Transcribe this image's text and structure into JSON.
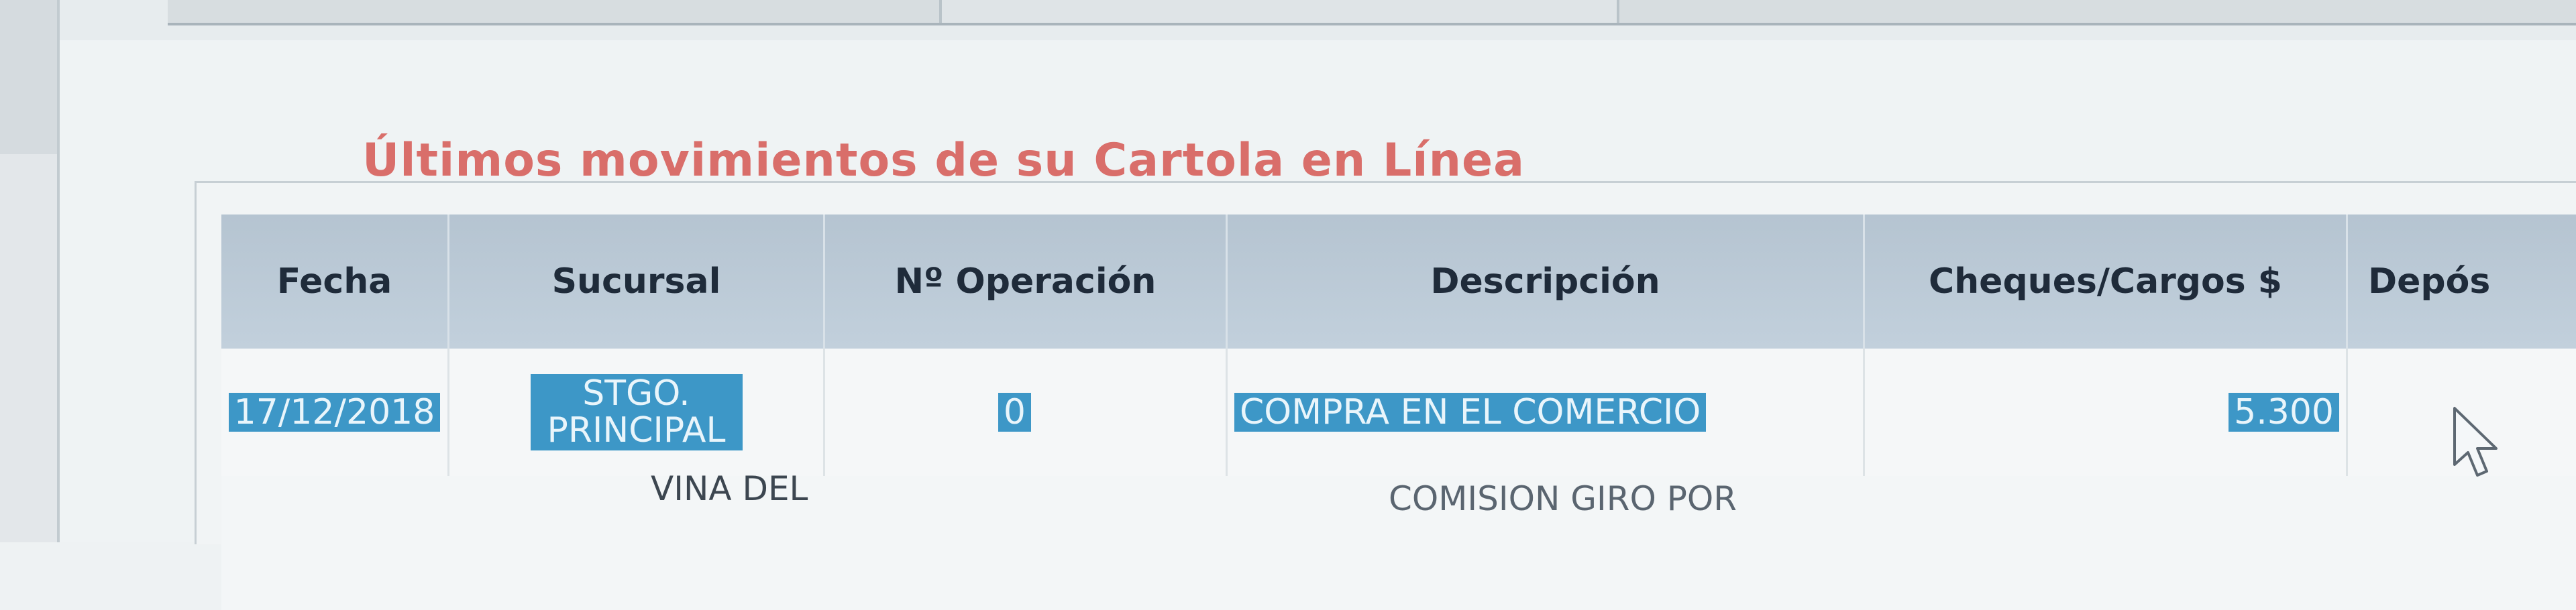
{
  "section": {
    "title": "Últimos movimientos de su Cartola en Línea"
  },
  "table": {
    "columns": [
      "Fecha",
      "Sucursal",
      "Nº Operación",
      "Descripción",
      "Cheques/Cargos $",
      "Depós"
    ],
    "rows": [
      {
        "fecha": "17/12/2018",
        "sucursal": "STGO. PRINCIPAL",
        "operacion": "0",
        "descripcion": "COMPRA EN EL COMERCIO",
        "cargos": "5.300",
        "depositos": ""
      },
      {
        "fecha": "",
        "sucursal": "VINA DEL",
        "operacion": "",
        "descripcion": "COMISION GIRO POR",
        "cargos": "",
        "depositos": ""
      }
    ]
  },
  "colors": {
    "title": "#d96e6a",
    "header_bg": "#b5c4d1",
    "selection": "#3d97c7"
  },
  "icons": {
    "cursor": "mouse-pointer-icon"
  }
}
